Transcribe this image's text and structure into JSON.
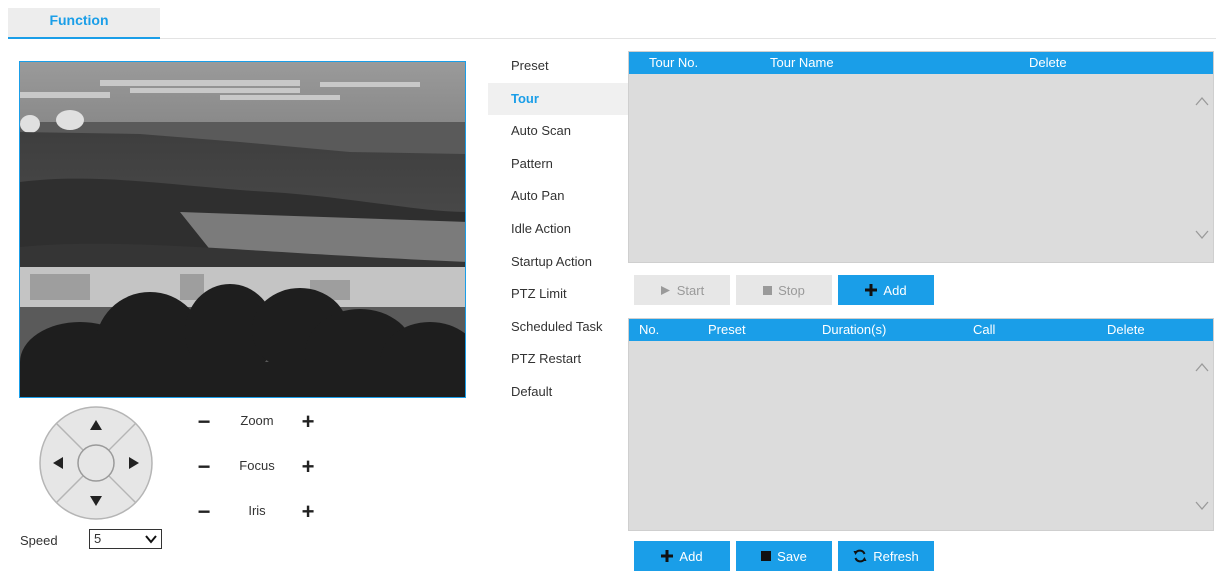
{
  "tabs": {
    "function_label": "Function"
  },
  "ptz": {
    "zoom_label": "Zoom",
    "focus_label": "Focus",
    "iris_label": "Iris",
    "minus_symbol": "−",
    "plus_symbol": "+",
    "speed_label": "Speed",
    "speed_value": "5"
  },
  "menu": {
    "items": [
      {
        "label": "Preset"
      },
      {
        "label": "Tour"
      },
      {
        "label": "Auto Scan"
      },
      {
        "label": "Pattern"
      },
      {
        "label": "Auto Pan"
      },
      {
        "label": "Idle Action"
      },
      {
        "label": "Startup Action"
      },
      {
        "label": "PTZ Limit"
      },
      {
        "label": "Scheduled Task"
      },
      {
        "label": "PTZ Restart"
      },
      {
        "label": "Default"
      }
    ],
    "active": "Tour"
  },
  "tour_table": {
    "columns": [
      "Tour No.",
      "Tour Name",
      "Delete"
    ]
  },
  "tour_buttons": {
    "start_label": "Start",
    "stop_label": "Stop",
    "add_label": "Add"
  },
  "preset_table": {
    "columns": [
      "No.",
      "Preset",
      "Duration(s)",
      "Call",
      "Delete"
    ]
  },
  "preset_buttons": {
    "add_label": "Add",
    "save_label": "Save",
    "refresh_label": "Refresh"
  },
  "colors": {
    "accent": "#1a9ee8",
    "table_bg": "#dcdcdc",
    "disabled_bg": "#e7e7e7"
  },
  "icons": {
    "start": "play-icon",
    "stop": "stop-square-icon",
    "add": "plus-icon",
    "save": "save-square-icon",
    "refresh": "refresh-icon",
    "scroll_up": "chevron-up-icon",
    "scroll_down": "chevron-down-icon"
  }
}
